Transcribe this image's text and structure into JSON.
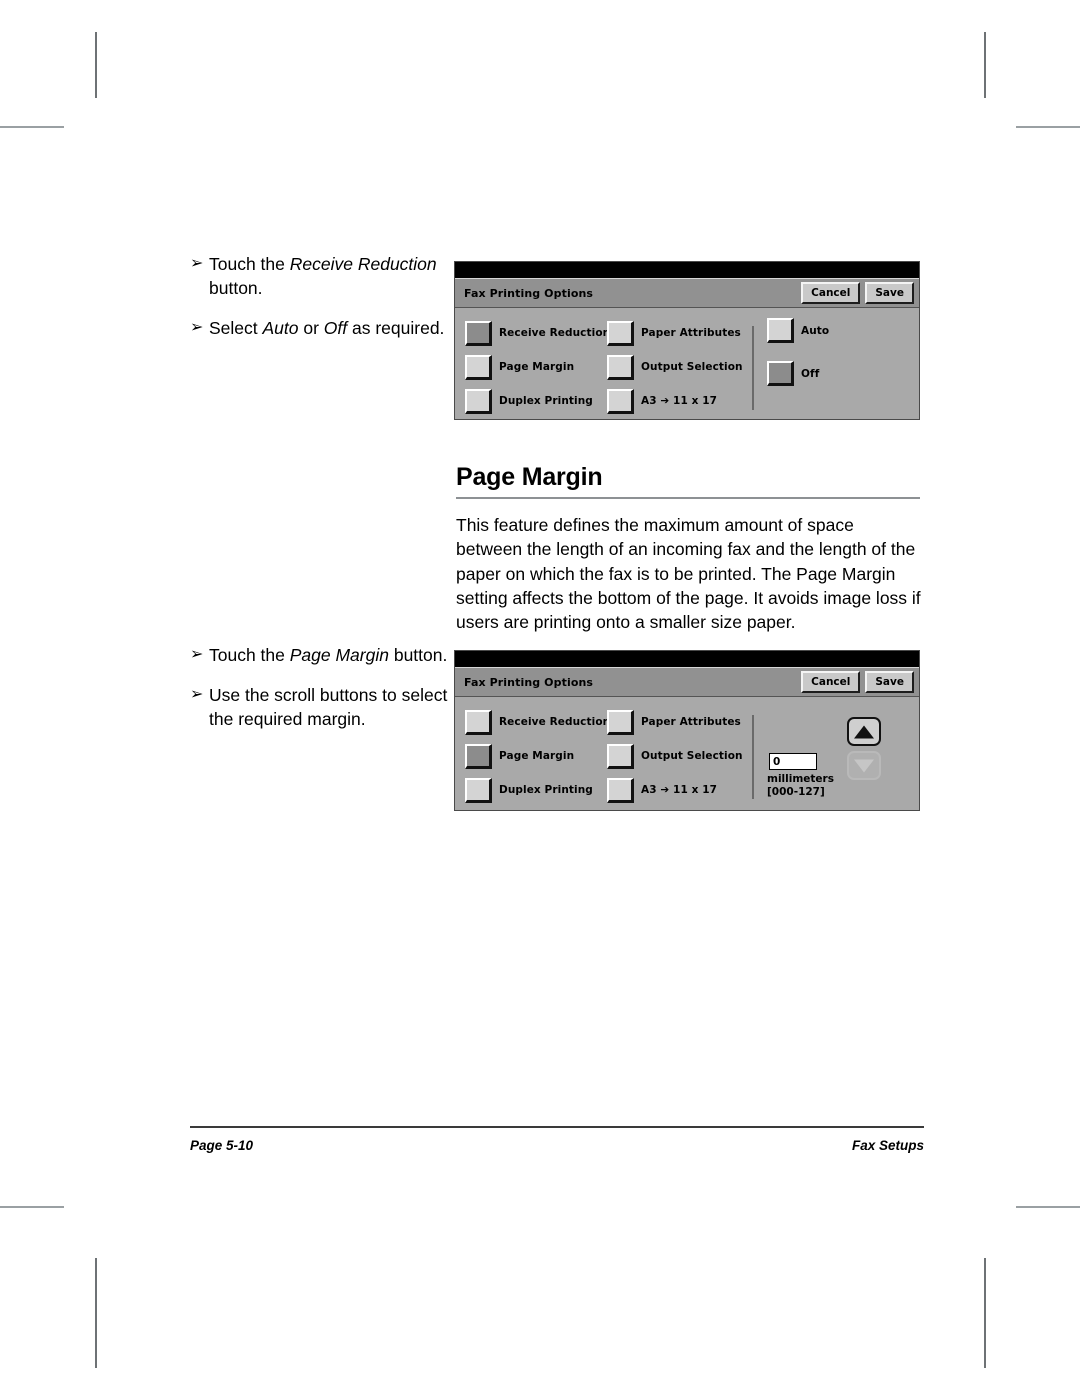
{
  "document": {
    "footer": {
      "page_label": "Page 5-10",
      "section_label": "Fax Setups"
    }
  },
  "section": {
    "heading": "Page Margin",
    "body": "This feature defines the maximum amount of space between the length of an incoming fax and the length of the paper on which the fax is to be printed. The Page Margin setting affects the bottom of the page. It avoids image loss if users are printing onto a smaller size paper."
  },
  "instructions_top": {
    "bullet_glyph": "➢",
    "items": [
      {
        "pre": "Touch the ",
        "emphasis": "Receive Reduction",
        "post": " button."
      },
      {
        "pre": "Select ",
        "emphasis": "Auto",
        "mid": " or ",
        "emphasis2": "Off",
        "post": " as required."
      }
    ]
  },
  "instructions_bottom": {
    "bullet_glyph": "➢",
    "items": [
      {
        "pre": "Touch the ",
        "emphasis": "Page Margin",
        "post": " button."
      },
      {
        "pre": "Use the scroll buttons to select the required margin.",
        "emphasis": "",
        "post": ""
      }
    ]
  },
  "panel_one": {
    "title": "Fax Printing Options",
    "cancel_label": "Cancel",
    "save_label": "Save",
    "options_left": [
      {
        "label": "Receive Reduction",
        "selected": true
      },
      {
        "label": "Page Margin",
        "selected": false
      },
      {
        "label": "Duplex Printing",
        "selected": false
      }
    ],
    "options_mid": [
      {
        "label": "Paper Attributes",
        "selected": false
      },
      {
        "label": "Output Selection",
        "selected": false
      },
      {
        "label": "A3 ➔ 11 x 17",
        "selected": false
      }
    ],
    "options_right": [
      {
        "label": "Auto",
        "selected": false
      },
      {
        "label": "Off",
        "selected": true
      }
    ]
  },
  "panel_two": {
    "title": "Fax Printing Options",
    "cancel_label": "Cancel",
    "save_label": "Save",
    "options_left": [
      {
        "label": "Receive Reduction",
        "selected": false
      },
      {
        "label": "Page Margin",
        "selected": true
      },
      {
        "label": "Duplex Printing",
        "selected": false
      }
    ],
    "options_mid": [
      {
        "label": "Paper Attributes",
        "selected": false
      },
      {
        "label": "Output Selection",
        "selected": false
      },
      {
        "label": "A3 ➔ 11 x 17",
        "selected": false
      }
    ],
    "stepper": {
      "value": "0",
      "unit_label": "millimeters",
      "range_label": "[000-127]",
      "up_enabled": true,
      "down_enabled": false
    }
  },
  "colors": {
    "panel_background": "#a9a9a9",
    "panel_titlebar": "#919191",
    "panel_topstrip": "#000000",
    "button_face": "#d4d4d4",
    "button_selected": "#8c8c8c",
    "rule": "#8d9194"
  }
}
